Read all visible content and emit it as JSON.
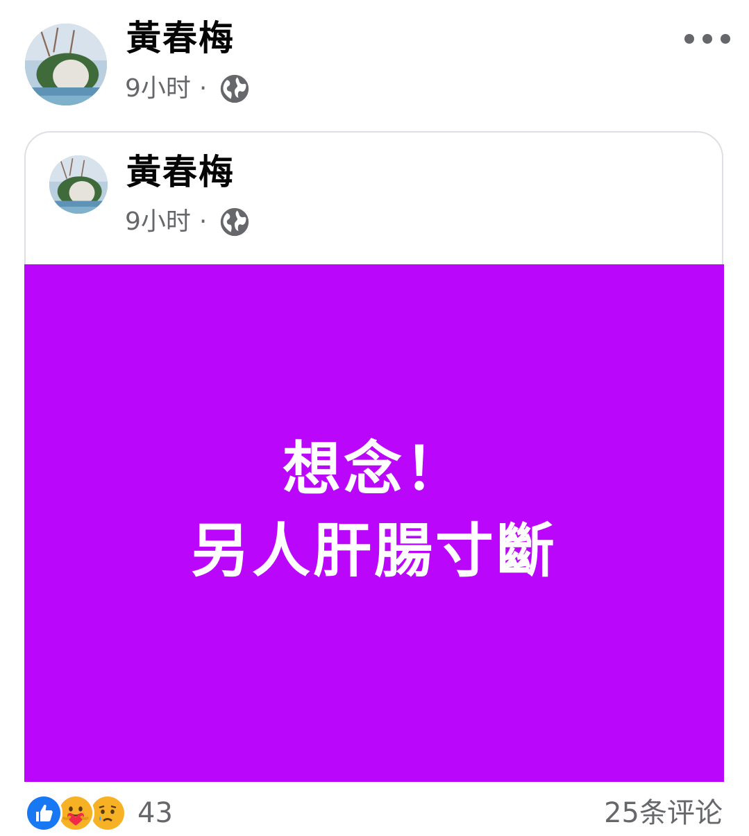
{
  "post": {
    "author": "黃春梅",
    "time": "9小时",
    "separator": "·",
    "privacy_icon": "globe-icon",
    "more_icon": "more-horizontal-icon"
  },
  "shared_post": {
    "author": "黃春梅",
    "time": "9小时",
    "separator": "·",
    "privacy_icon": "globe-icon",
    "background_color": "#bb06fc",
    "text_lines": [
      "想念！",
      "另人肝腸寸斷"
    ]
  },
  "footer": {
    "reaction_icons": [
      "like-icon",
      "care-icon",
      "sad-icon"
    ],
    "reaction_count": "43",
    "comments": "25条评论"
  },
  "colors": {
    "secondary_text": "#65676b",
    "like_blue": "#1877f2",
    "emoji_yellow": "#f7b125"
  }
}
